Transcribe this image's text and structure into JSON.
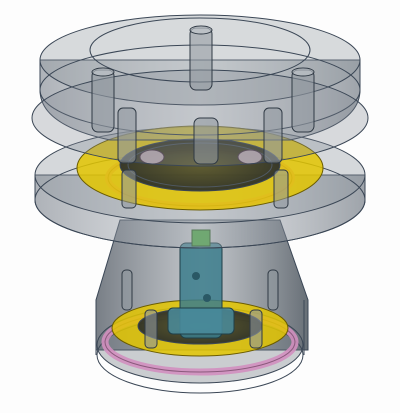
{
  "viewport": {
    "background": "#fdfdfd",
    "render_mode": "transparent-xray",
    "shell_color": "#7f8790",
    "edge_color": "#3b4756",
    "ring_color": "#e3c500",
    "gasket_color": "#d18fbf",
    "inner_part_color": "#3b7c8c",
    "accent_color": "#4fa24a"
  },
  "components": [
    {
      "name": "upper-cap"
    },
    {
      "name": "middle-flange"
    },
    {
      "name": "yellow-ring-upper"
    },
    {
      "name": "pink-gasket-upper"
    },
    {
      "name": "conical-body"
    },
    {
      "name": "yellow-ring-lower"
    },
    {
      "name": "pink-gasket-lower"
    },
    {
      "name": "teal-core-assembly"
    },
    {
      "name": "standoff-posts"
    }
  ]
}
